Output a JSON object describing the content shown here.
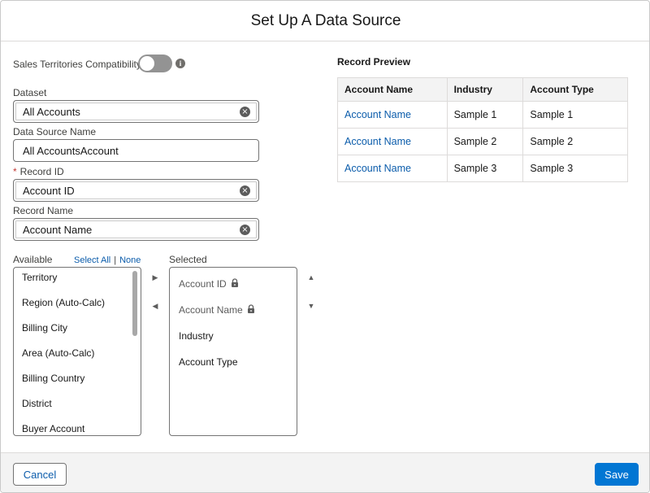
{
  "modal": {
    "title": "Set Up A Data Source"
  },
  "form": {
    "compat_label": "Sales Territories Compatibility",
    "compat_enabled": false,
    "info_glyph": "i",
    "dataset_label": "Dataset",
    "dataset_value": "All Accounts",
    "data_source_name_label": "Data Source Name",
    "data_source_name_value": "All AccountsAccount",
    "required_marker": "*",
    "record_id_label": "Record ID",
    "record_id_value": "Account ID",
    "record_name_label": "Record Name",
    "record_name_value": "Account Name",
    "clear_glyph": "×"
  },
  "dual_list": {
    "available_label": "Available",
    "select_all": "Select All",
    "separator": "|",
    "none": "None",
    "selected_label": "Selected",
    "available_items": [
      "Territory",
      "Region (Auto-Calc)",
      "Billing City",
      "Area (Auto-Calc)",
      "Billing Country",
      "District",
      "Buyer Account"
    ],
    "selected_items": [
      {
        "label": "Account ID",
        "locked": true
      },
      {
        "label": "Account Name",
        "locked": true
      },
      {
        "label": "Industry",
        "locked": false
      },
      {
        "label": "Account Type",
        "locked": false
      }
    ]
  },
  "preview": {
    "title": "Record Preview",
    "columns": [
      "Account Name",
      "Industry",
      "Account Type"
    ],
    "rows": [
      [
        "Account Name",
        "Sample 1",
        "Sample 1"
      ],
      [
        "Account Name",
        "Sample 2",
        "Sample 2"
      ],
      [
        "Account Name",
        "Sample 3",
        "Sample 3"
      ]
    ]
  },
  "footer": {
    "cancel_label": "Cancel",
    "save_label": "Save"
  },
  "colors": {
    "brand": "#0176d3",
    "link": "#0b5cab",
    "required": "#c23934",
    "toggle_off": "#939393"
  },
  "icons": {
    "info": "info-icon",
    "clear": "clear-icon",
    "lock": "lock-icon",
    "move_right": "arrow-right-icon",
    "move_left": "arrow-left-icon",
    "move_up": "arrow-up-icon",
    "move_down": "arrow-down-icon"
  }
}
